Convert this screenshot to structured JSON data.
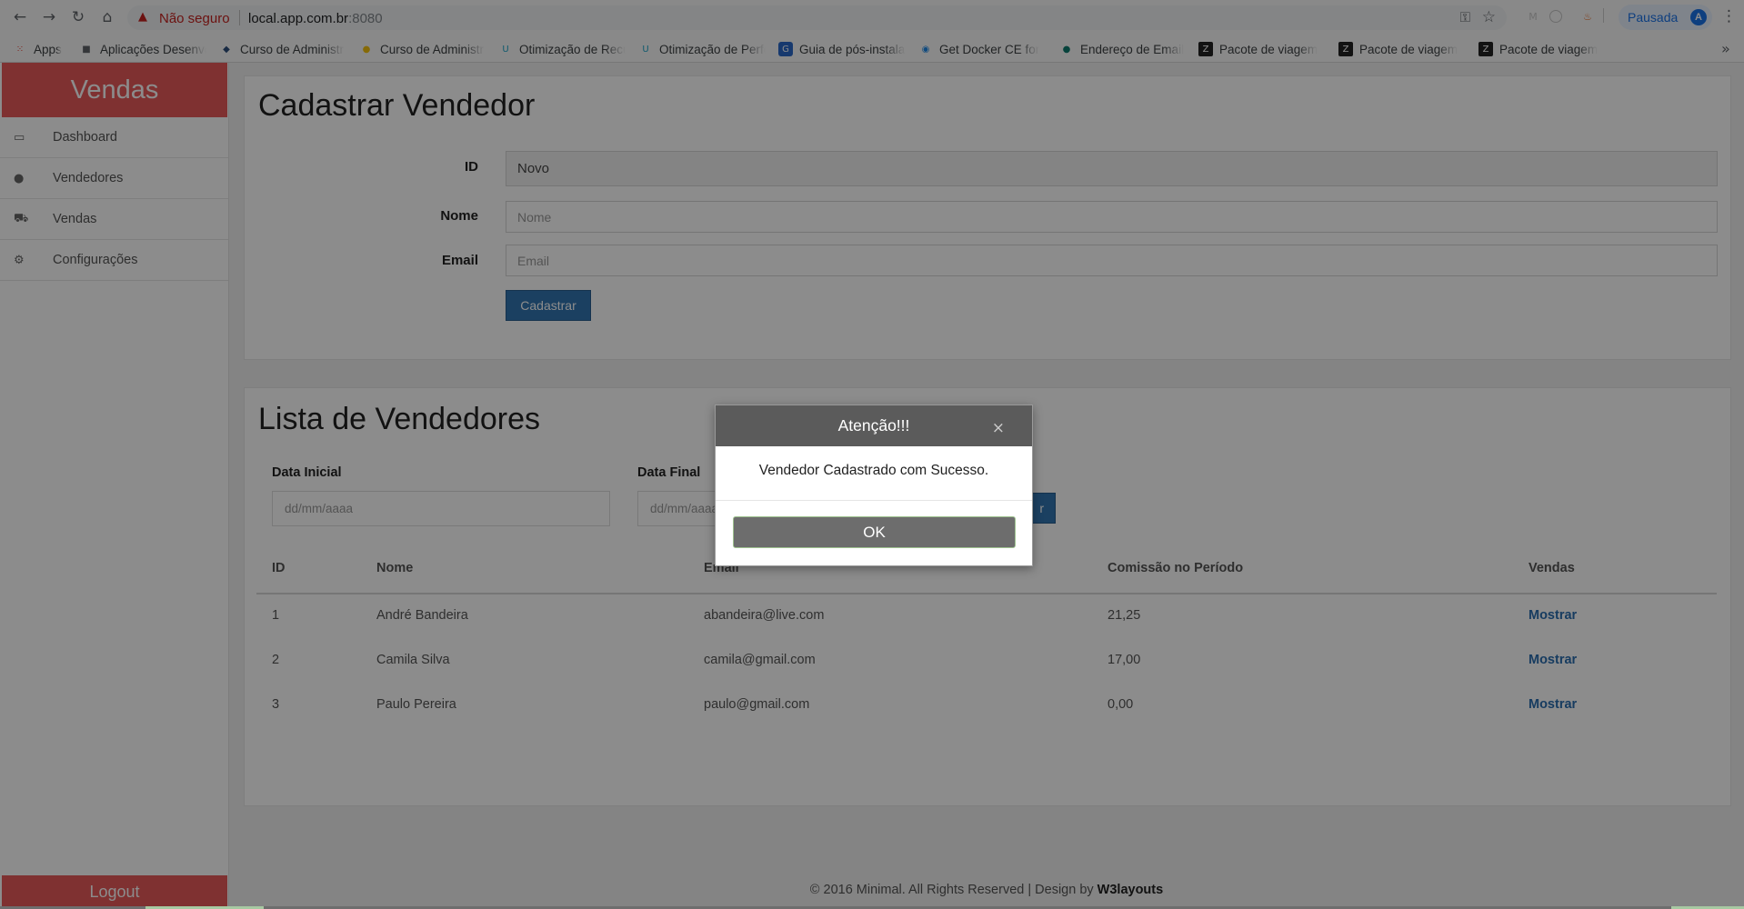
{
  "browser": {
    "security_label": "Não seguro",
    "url_host": "local.app.com.br",
    "url_port": ":8080",
    "profile_label": "Pausada",
    "profile_initial": "A",
    "bookmarks": [
      {
        "label": "Apps",
        "icon": "apps-grid-icon"
      },
      {
        "label": "Aplicações Desenvolvimento",
        "icon": "folder-icon"
      },
      {
        "label": "Curso de Administração",
        "icon": "course-icon"
      },
      {
        "label": "Curso de Administração",
        "icon": "course-yellow-icon"
      },
      {
        "label": "Otimização de Recursos",
        "icon": "udemy-icon"
      },
      {
        "label": "Otimização de Performance",
        "icon": "udemy-icon"
      },
      {
        "label": "Guia de pós-instalação",
        "icon": "guide-icon"
      },
      {
        "label": "Get Docker CE for",
        "icon": "docker-icon"
      },
      {
        "label": "Endereço de Email",
        "icon": "email-icon"
      },
      {
        "label": "Pacote de viagem",
        "icon": "travel-icon"
      },
      {
        "label": "Pacote de viagem",
        "icon": "travel-icon"
      },
      {
        "label": "Pacote de viagem",
        "icon": "travel-icon"
      }
    ]
  },
  "sidebar": {
    "brand": "Vendas",
    "items": [
      {
        "label": "Dashboard",
        "icon": "monitor-icon"
      },
      {
        "label": "Vendedores",
        "icon": "user-icon"
      },
      {
        "label": "Vendas",
        "icon": "cart-icon"
      },
      {
        "label": "Configurações",
        "icon": "gears-icon"
      }
    ],
    "logout": "Logout"
  },
  "form": {
    "title": "Cadastrar Vendedor",
    "id_label": "ID",
    "id_value": "Novo",
    "name_label": "Nome",
    "name_placeholder": "Nome",
    "email_label": "Email",
    "email_placeholder": "Email",
    "submit_label": "Cadastrar"
  },
  "list": {
    "title": "Lista de Vendedores",
    "start_label": "Data Inicial",
    "start_placeholder": "dd/mm/aaaa",
    "end_label": "Data Final",
    "end_placeholder": "dd/mm/aaaa",
    "filter_button_partial": "r",
    "columns": [
      "ID",
      "Nome",
      "Email",
      "Comissão no Período",
      "Vendas"
    ],
    "rows": [
      {
        "id": "1",
        "name": "André Bandeira",
        "email": "abandeira@live.com",
        "commission": "21,25",
        "action": "Mostrar"
      },
      {
        "id": "2",
        "name": "Camila Silva",
        "email": "camila@gmail.com",
        "commission": "17,00",
        "action": "Mostrar"
      },
      {
        "id": "3",
        "name": "Paulo Pereira",
        "email": "paulo@gmail.com",
        "commission": "0,00",
        "action": "Mostrar"
      }
    ]
  },
  "footer": {
    "text": "© 2016 Minimal. All Rights Reserved | Design by",
    "link": "W3layouts"
  },
  "modal": {
    "title": "Atenção!!!",
    "message": "Vendedor Cadastrado com Sucesso.",
    "ok_label": "OK"
  },
  "colors": {
    "brand_red": "#e8595a",
    "primary_blue": "#3276b1",
    "link_blue": "#2a6db0",
    "modal_header": "#5b5b5b"
  }
}
